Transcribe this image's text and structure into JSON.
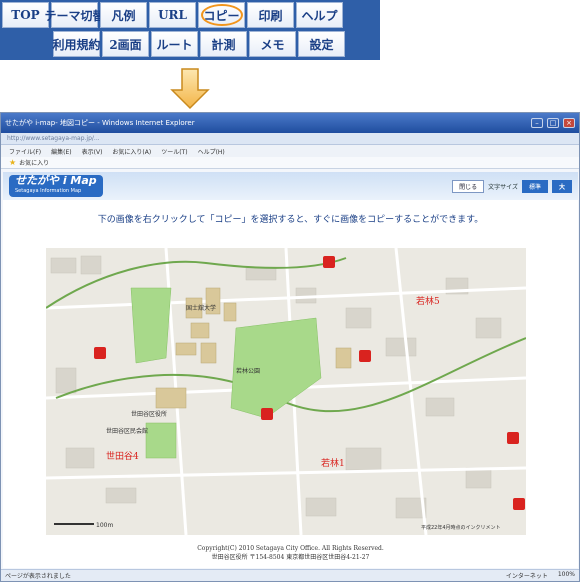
{
  "menu": {
    "row1": [
      "TOP",
      "テーマ切替",
      "凡例",
      "URL",
      "コピー",
      "印刷",
      "ヘルプ"
    ],
    "row2": [
      "利用規約",
      "2画面",
      "ルート",
      "計測",
      "メモ",
      "設定"
    ],
    "active_item": "コピー"
  },
  "browser": {
    "title": "せたがや i-map- 地図コピー - Windows Internet Explorer",
    "address": "http://www.setagaya-map.jp/...",
    "menubar": [
      "ファイル(F)",
      "編集(E)",
      "表示(V)",
      "お気に入り(A)",
      "ツール(T)",
      "ヘルプ(H)"
    ],
    "favorites": "お気に入り",
    "status_left": "ページが表示されました",
    "status_zone": "インターネット",
    "zoom": "100%"
  },
  "site": {
    "logo_main": "せたがや i Map",
    "logo_sub": "Setagaya Information Map",
    "close_label": "閉じる",
    "font_size_label": "文字サイズ",
    "font_small": "標準",
    "font_large": "大",
    "instruction": "下の画像を右クリックして「コピー」を選択すると、すぐに画像をコピーすることができます。",
    "copyright": "Copyright(C) 2010 Setagaya City Office. All Rights Reserved.",
    "address_line": "世田谷区役所 〒154-8504 東京都世田谷区世田谷4-21-27"
  },
  "map": {
    "labels": [
      "国士舘大学",
      "世田谷区役所",
      "世田谷4",
      "若林5",
      "若林1",
      "若林公園",
      "世田谷区民会館"
    ],
    "scale": "100m",
    "note": "平成22年4月時点のインクリメント"
  },
  "colors": {
    "menu_bg": "#2f5fa8",
    "active_ring": "#f2951c",
    "park_green": "#a8d98a",
    "building": "#d9c89a"
  }
}
